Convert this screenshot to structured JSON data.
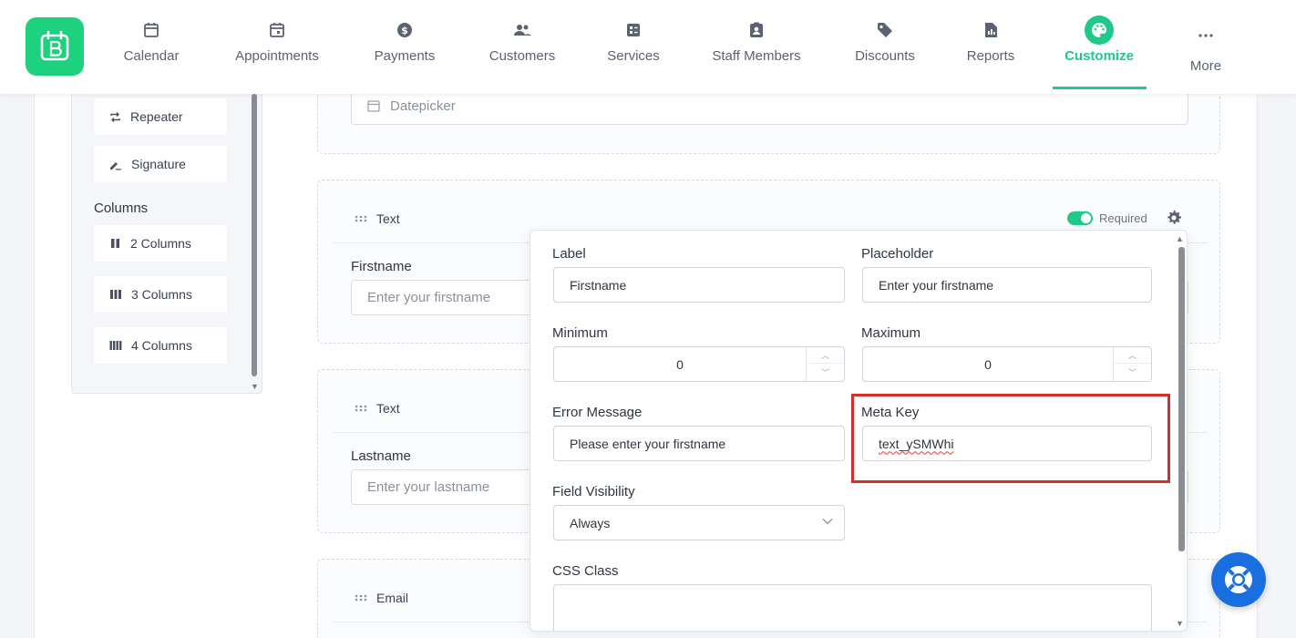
{
  "nav": {
    "items": [
      {
        "label": "Calendar",
        "icon": "calendar-icon"
      },
      {
        "label": "Appointments",
        "icon": "calendar-check-icon"
      },
      {
        "label": "Payments",
        "icon": "dollar-icon"
      },
      {
        "label": "Customers",
        "icon": "users-icon"
      },
      {
        "label": "Services",
        "icon": "services-icon"
      },
      {
        "label": "Staff Members",
        "icon": "staff-icon"
      },
      {
        "label": "Discounts",
        "icon": "tag-icon"
      },
      {
        "label": "Reports",
        "icon": "report-icon"
      },
      {
        "label": "Customize",
        "icon": "palette-icon"
      },
      {
        "label": "More",
        "icon": "more-icon"
      }
    ],
    "active": "Customize",
    "accent": "#1ec98a",
    "logo_color": "#1ed17f"
  },
  "sidebar": {
    "tools": [
      {
        "label": "Repeater",
        "icon": "repeat-icon"
      },
      {
        "label": "Signature",
        "icon": "signature-icon"
      }
    ],
    "columns_heading": "Columns",
    "columns": [
      {
        "label": "2 Columns",
        "icon": "two-columns-icon"
      },
      {
        "label": "3 Columns",
        "icon": "three-columns-icon"
      },
      {
        "label": "4 Columns",
        "icon": "four-columns-icon"
      }
    ]
  },
  "form": {
    "datepicker": {
      "placeholder": "Datepicker"
    },
    "cards": [
      {
        "type": "Text",
        "label": "Firstname",
        "placeholder": "Enter your firstname",
        "required_label": "Required",
        "required": true
      },
      {
        "type": "Text",
        "label": "Lastname",
        "placeholder": "Enter your lastname"
      },
      {
        "type": "Email"
      }
    ]
  },
  "settings": {
    "label": {
      "title": "Label",
      "value": "Firstname"
    },
    "placeholder": {
      "title": "Placeholder",
      "value": "Enter your firstname"
    },
    "minimum": {
      "title": "Minimum",
      "value": "0"
    },
    "maximum": {
      "title": "Maximum",
      "value": "0"
    },
    "error_message": {
      "title": "Error Message",
      "value": "Please enter your firstname"
    },
    "meta_key": {
      "title": "Meta Key",
      "value": "text_ySMWhi"
    },
    "field_visibility": {
      "title": "Field Visibility",
      "value": "Always"
    },
    "css_class": {
      "title": "CSS Class",
      "value": ""
    }
  },
  "colors": {
    "highlight": "#d32f2f",
    "help_button": "#1a6fe0"
  }
}
